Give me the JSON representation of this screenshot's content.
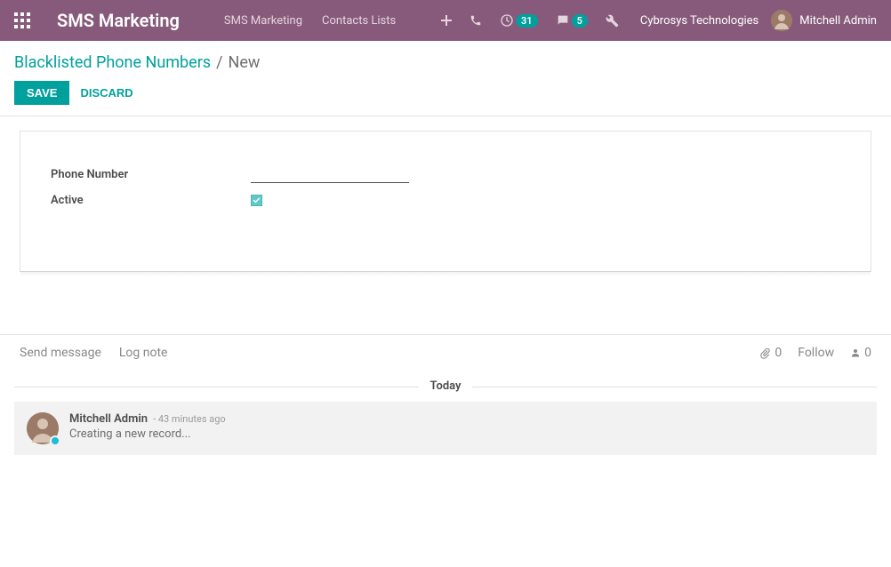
{
  "header": {
    "brand": "SMS Marketing",
    "nav": [
      {
        "label": "SMS Marketing"
      },
      {
        "label": "Contacts Lists"
      }
    ],
    "activities_badge": "31",
    "messages_badge": "5",
    "company": "Cybrosys Technologies",
    "user_name": "Mitchell Admin"
  },
  "breadcrumb": {
    "parent": "Blacklisted Phone Numbers",
    "sep": "/",
    "current": "New"
  },
  "actions": {
    "save": "Save",
    "discard": "Discard"
  },
  "form": {
    "phone_label": "Phone Number",
    "phone_value": "",
    "active_label": "Active",
    "active_checked": true
  },
  "chatter": {
    "send_message": "Send message",
    "log_note": "Log note",
    "attach_count": "0",
    "follow_label": "Follow",
    "followers_count": "0",
    "date_separator": "Today"
  },
  "messages": [
    {
      "author": "Mitchell Admin",
      "time": "- 43 minutes ago",
      "body": "Creating a new record..."
    }
  ]
}
